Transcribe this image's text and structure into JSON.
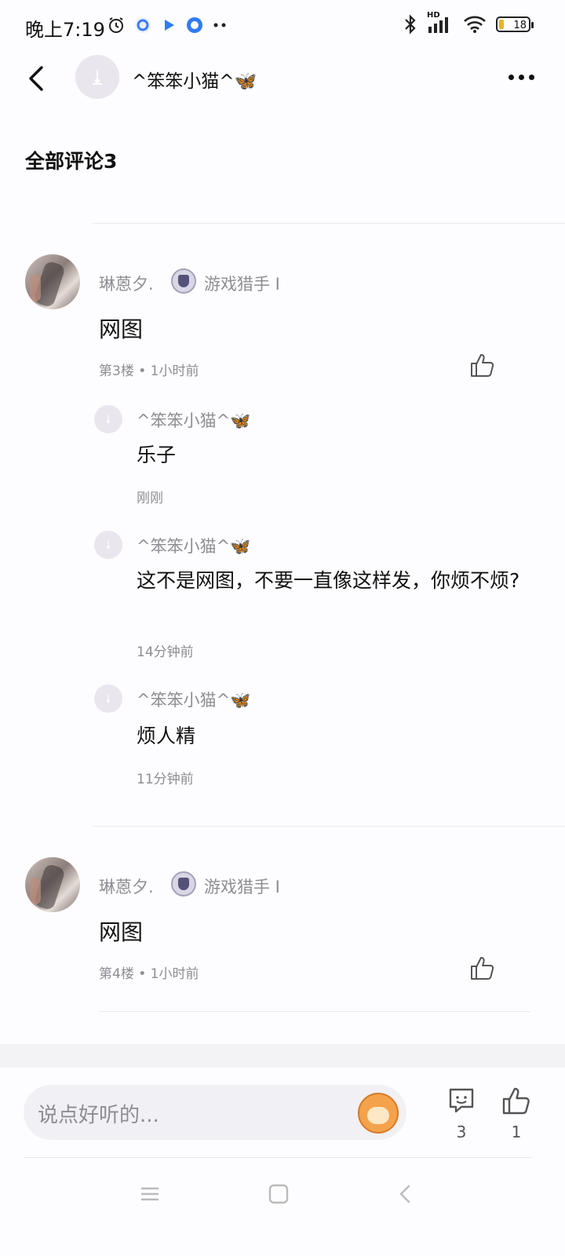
{
  "status_bar": {
    "time": "晚上7:19",
    "battery": "18",
    "net_label": "HD"
  },
  "header": {
    "username": "^笨笨小猫^🦋"
  },
  "comments_header": {
    "title": "全部评论3"
  },
  "comments": [
    {
      "author": "琳蒽夕.",
      "badge_label": "游戏猎手 I",
      "text": "网图",
      "meta": "第3楼 • 1小时前",
      "replies": [
        {
          "author": "^笨笨小猫^🦋",
          "text": "乐子",
          "time": "刚刚"
        },
        {
          "author": "^笨笨小猫^🦋",
          "text": "这不是网图，不要一直像这样发，你烦不烦?",
          "time": "14分钟前"
        },
        {
          "author": "^笨笨小猫^🦋",
          "text": "烦人精",
          "time": "11分钟前"
        }
      ]
    },
    {
      "author": "琳蒽夕.",
      "badge_label": "游戏猎手 I",
      "text": "网图",
      "meta": "第4楼 • 1小时前",
      "replies": []
    }
  ],
  "footer": {
    "input_placeholder": "说点好听的...",
    "comment_count": "3",
    "like_count": "1"
  }
}
